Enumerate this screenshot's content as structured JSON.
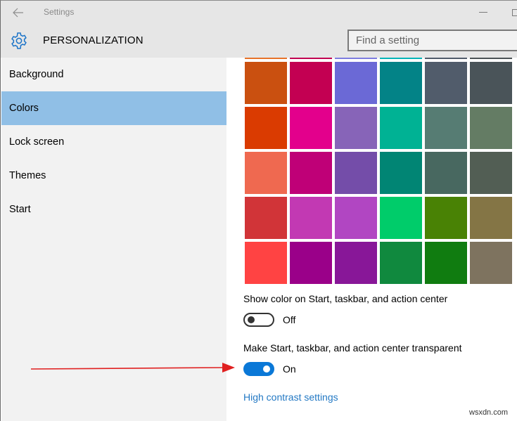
{
  "window": {
    "title": "Settings",
    "back_icon": "arrow-left-icon",
    "minimize_icon": "minimize-icon",
    "maximize_icon": "maximize-icon"
  },
  "header": {
    "icon": "gear-icon",
    "title": "PERSONALIZATION",
    "search_placeholder": "Find a setting"
  },
  "sidebar": {
    "items": [
      {
        "label": "Background",
        "selected": false
      },
      {
        "label": "Colors",
        "selected": true
      },
      {
        "label": "Lock screen",
        "selected": false
      },
      {
        "label": "Themes",
        "selected": false
      },
      {
        "label": "Start",
        "selected": false
      }
    ],
    "selected_color": "#90bfe6"
  },
  "content": {
    "accent_colors": [
      [
        "#e7732a",
        "#c30052",
        "#7e7de0",
        "#03b4b8",
        "#515c6b",
        "#4c5356"
      ],
      [
        "#ca5010",
        "#c30052",
        "#6b69d6",
        "#038387",
        "#515c6b",
        "#4a5459"
      ],
      [
        "#da3b01",
        "#e3008c",
        "#8764b8",
        "#00b294",
        "#567c73",
        "#647c64"
      ],
      [
        "#ef6950",
        "#bf0077",
        "#744da9",
        "#018574",
        "#486860",
        "#525e54"
      ],
      [
        "#d13438",
        "#c239b3",
        "#b146c2",
        "#00cc6a",
        "#498205",
        "#847545"
      ],
      [
        "#ff4343",
        "#9a0089",
        "#881798",
        "#10893e",
        "#107c10",
        "#7e735f"
      ]
    ],
    "show_color_label": "Show color on Start, taskbar, and action center",
    "show_color_state": "Off",
    "show_color_on": false,
    "transparent_label": "Make Start, taskbar, and action center transparent",
    "transparent_state": "On",
    "transparent_on": true,
    "high_contrast_link": "High contrast settings"
  },
  "annotation": {
    "arrow_color": "#e02020"
  },
  "watermark": "wsxdn.com",
  "colors": {
    "accent": "#0a78d7",
    "link": "#2379c4"
  }
}
